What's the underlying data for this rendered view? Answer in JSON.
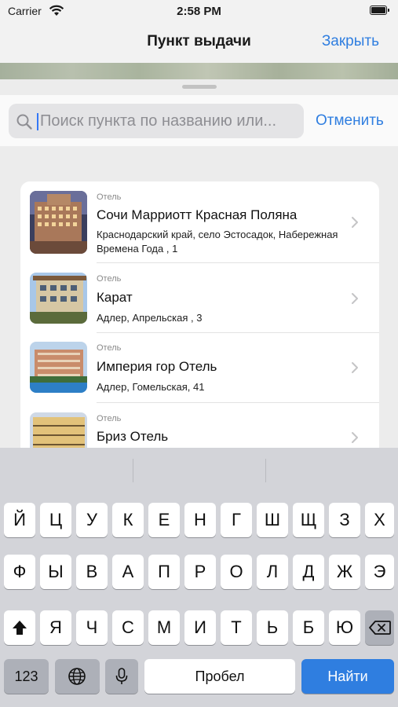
{
  "status_bar": {
    "carrier": "Carrier",
    "time": "2:58 PM"
  },
  "nav": {
    "title": "Пункт выдачи",
    "close_label": "Закрыть"
  },
  "search": {
    "placeholder": "Поиск пункта по названию или...",
    "value": "",
    "cancel_label": "Отменить"
  },
  "list": {
    "items": [
      {
        "category": "Отель",
        "name": "Сочи Марриотт Красная Поляна",
        "address": "Краснодарский край,  село Эстосадок, Набережная Времена Года , 1"
      },
      {
        "category": "Отель",
        "name": "Карат",
        "address": "Адлер, Апрельская , 3"
      },
      {
        "category": "Отель",
        "name": "Империя гор Отель",
        "address": "Адлер, Гомельская, 41"
      },
      {
        "category": "Отель",
        "name": "Бриз Отель",
        "address": ""
      }
    ]
  },
  "keyboard": {
    "row1": [
      "Й",
      "Ц",
      "У",
      "К",
      "Е",
      "Н",
      "Г",
      "Ш",
      "Щ",
      "З",
      "Х"
    ],
    "row2": [
      "Ф",
      "Ы",
      "В",
      "А",
      "П",
      "Р",
      "О",
      "Л",
      "Д",
      "Ж",
      "Э"
    ],
    "row3": [
      "Я",
      "Ч",
      "С",
      "М",
      "И",
      "Т",
      "Ь",
      "Б",
      "Ю"
    ],
    "numbers_label": "123",
    "space_label": "Пробел",
    "go_label": "Найти"
  }
}
